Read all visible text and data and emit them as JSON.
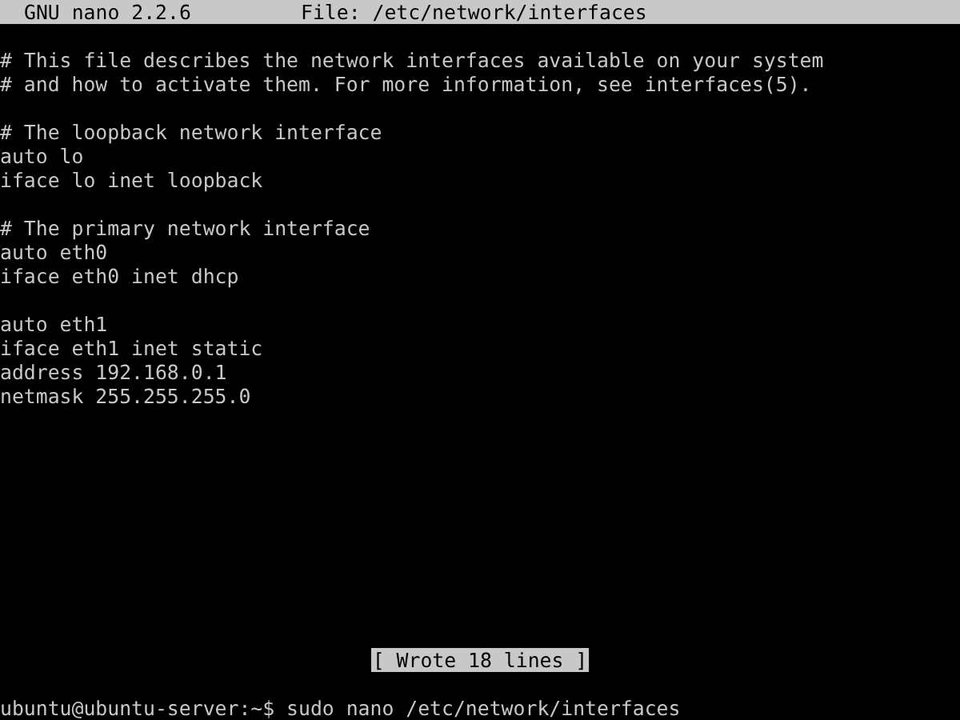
{
  "title_bar": {
    "app": "GNU nano 2.2.6",
    "file": "File: /etc/network/interfaces"
  },
  "editor": {
    "paragraphs": [
      [
        "# This file describes the network interfaces available on your system",
        "# and how to activate them. For more information, see interfaces(5)."
      ],
      [
        "# The loopback network interface",
        "auto lo",
        "iface lo inet loopback"
      ],
      [
        "# The primary network interface",
        "auto eth0",
        "iface eth0 inet dhcp"
      ],
      [
        "auto eth1",
        "iface eth1 inet static",
        "address 192.168.0.1",
        "netmask 255.255.255.0"
      ]
    ]
  },
  "status_message": "[ Wrote 18 lines ]",
  "shell_prompt": "ubuntu@ubuntu-server:~$ sudo nano /etc/network/interfaces"
}
